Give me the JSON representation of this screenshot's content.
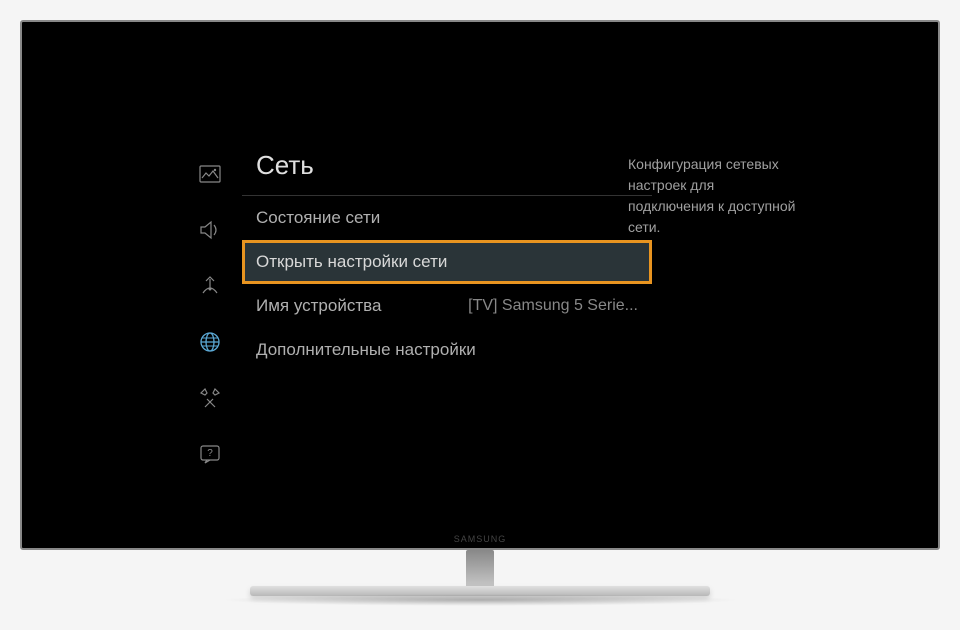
{
  "sidebar": {
    "items": [
      {
        "name": "picture-icon"
      },
      {
        "name": "sound-icon"
      },
      {
        "name": "broadcast-icon"
      },
      {
        "name": "network-icon",
        "active": true
      },
      {
        "name": "tools-icon"
      },
      {
        "name": "support-icon"
      }
    ]
  },
  "menu": {
    "title": "Сеть",
    "items": [
      {
        "label": "Состояние сети",
        "value": "",
        "highlighted": false
      },
      {
        "label": "Открыть настройки сети",
        "value": "",
        "highlighted": true
      },
      {
        "label": "Имя устройства",
        "value": "[TV] Samsung 5 Serie...",
        "highlighted": false
      },
      {
        "label": "Дополнительные настройки",
        "value": "",
        "highlighted": false
      }
    ]
  },
  "description": "Конфигурация сетевых настроек для подключения к доступной сети."
}
